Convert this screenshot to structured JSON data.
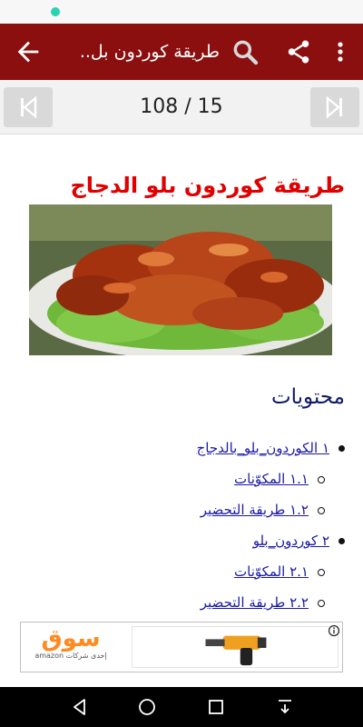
{
  "app_bar": {
    "title": "طريقة كوردون بل..",
    "back_icon": "arrow-back-icon",
    "search_icon": "search-icon",
    "share_icon": "share-icon",
    "more_icon": "more-vert-icon",
    "color": "#8b0f0f"
  },
  "pager": {
    "counter": "108 / 15",
    "prev_icon": "skip-previous-icon",
    "next_icon": "skip-next-icon"
  },
  "article": {
    "title": "طريقة كوردون بلو الدجاج",
    "title_color": "#e00000",
    "image_desc": "chicken-dish-image",
    "toc_heading": "محتويات",
    "toc": [
      {
        "label": "١ الكوردون_بلو_بالدجاج",
        "level": 1
      },
      {
        "label": "١.١ المكوّنات",
        "level": 2
      },
      {
        "label": "١.٢ طريقة التحضير",
        "level": 2
      },
      {
        "label": "٢ كوردون_بلو",
        "level": 1
      },
      {
        "label": "٢.١ المكوّنات",
        "level": 2
      },
      {
        "label": "٢.٢ طريقة التحضير",
        "level": 2
      }
    ]
  },
  "ad": {
    "brand": "سوق",
    "tagline": "إحدى شركات amazon",
    "info_icon": "info-icon",
    "product_icon": "drill-image"
  },
  "system_nav": {
    "back_icon": "nav-back-icon",
    "home_icon": "nav-home-icon",
    "recents_icon": "nav-recents-icon",
    "extra_icon": "nav-download-icon"
  }
}
